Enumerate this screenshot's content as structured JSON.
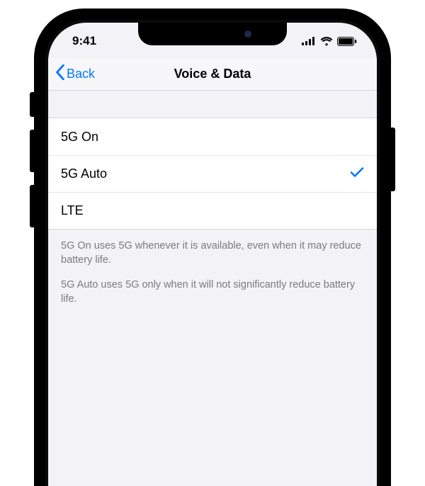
{
  "status": {
    "time": "9:41"
  },
  "nav": {
    "back_label": "Back",
    "title": "Voice & Data"
  },
  "options": {
    "items": [
      {
        "label": "5G On",
        "selected": false
      },
      {
        "label": "5G Auto",
        "selected": true
      },
      {
        "label": "LTE",
        "selected": false
      }
    ]
  },
  "footer": {
    "p1": "5G On uses 5G whenever it is available, even when it may reduce battery life.",
    "p2": "5G Auto uses 5G only when it will not significantly reduce battery life."
  },
  "colors": {
    "accent": "#007aff"
  }
}
